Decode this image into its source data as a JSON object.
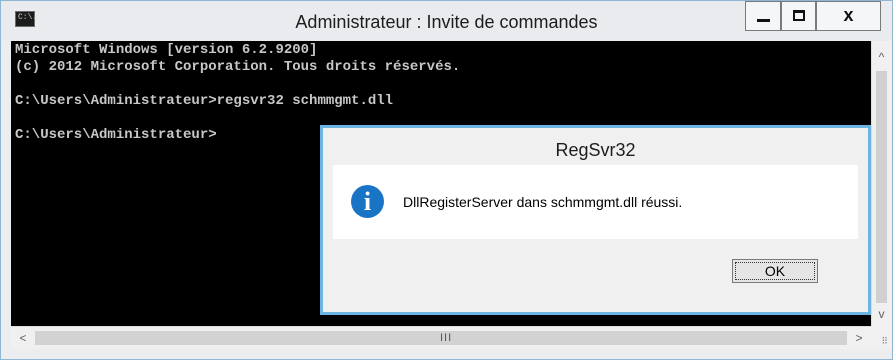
{
  "window": {
    "title": "Administrateur : Invite de commandes",
    "icon_text": "C:\\.",
    "controls": {
      "minimize": "minimize",
      "maximize": "maximize",
      "close": "x"
    }
  },
  "console": {
    "lines": [
      "Microsoft Windows [version 6.2.9200]",
      "(c) 2012 Microsoft Corporation. Tous droits réservés.",
      "",
      "C:\\Users\\Administrateur>regsvr32 schmmgmt.dll",
      "",
      "C:\\Users\\Administrateur>"
    ],
    "text_color": "#c7c7c7",
    "background": "#000000"
  },
  "scrollbars": {
    "vertical": {
      "up": "^",
      "down": "v"
    },
    "horizontal": {
      "left": "<",
      "right": ">",
      "grip": "III"
    }
  },
  "dialog": {
    "title": "RegSvr32",
    "message": "DllRegisterServer dans schmmgmt.dll réussi.",
    "icon": "info-icon",
    "icon_glyph": "i",
    "ok_label": "OK",
    "accent": "#6eb4e3"
  }
}
